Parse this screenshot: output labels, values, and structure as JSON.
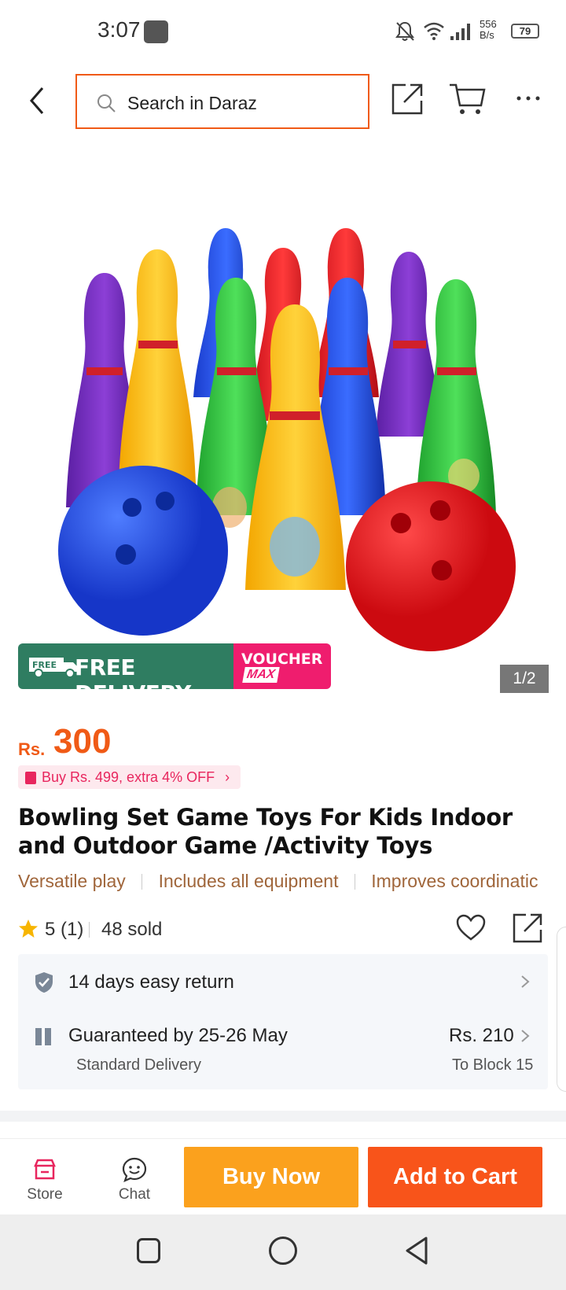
{
  "status_bar": {
    "time": "3:07",
    "net_speed_value": "556",
    "net_speed_unit": "B/s",
    "battery": "79"
  },
  "top_bar": {
    "search_placeholder": "Search in Daraz"
  },
  "product_image": {
    "counter": "1/2",
    "promo": {
      "free_badge": "FREE",
      "free_delivery": "FREE DELIVERY",
      "voucher": "VOUCHER",
      "voucher_max": "MAX"
    }
  },
  "price": {
    "currency": "Rs.",
    "value": "300"
  },
  "offer": {
    "text": "Buy Rs. 499, extra 4% OFF"
  },
  "product": {
    "title": "Bowling Set Game Toys For Kids Indoor and Outdoor Game /Activity Toys",
    "highlights": [
      "Versatile play",
      "Includes all equipment",
      "Improves coordinatic"
    ]
  },
  "rating": {
    "score": "5 (1)",
    "sold": "48 sold"
  },
  "service": {
    "return_text": "14 days easy return",
    "delivery_title": "Guaranteed by 25-26 May",
    "delivery_type": "Standard Delivery",
    "delivery_price": "Rs. 210",
    "delivery_destination": "To Block 15"
  },
  "bottom_bar": {
    "store_label": "Store",
    "chat_label": "Chat",
    "buy_now_label": "Buy Now",
    "add_to_cart_label": "Add to Cart"
  },
  "colors": {
    "brand_orange": "#f05a16",
    "buy_now": "#fba11d",
    "add_to_cart": "#f8541a",
    "free_delivery_green": "#2f7d61",
    "voucher_pink": "#ef1d6e",
    "highlight_brown": "#a0663b"
  },
  "icons": [
    "back-arrow-icon",
    "search-icon",
    "share-icon",
    "cart-icon",
    "more-icon",
    "star-icon",
    "heart-icon",
    "shield-icon",
    "box-icon",
    "chevron-right-icon",
    "store-icon",
    "chat-icon"
  ]
}
